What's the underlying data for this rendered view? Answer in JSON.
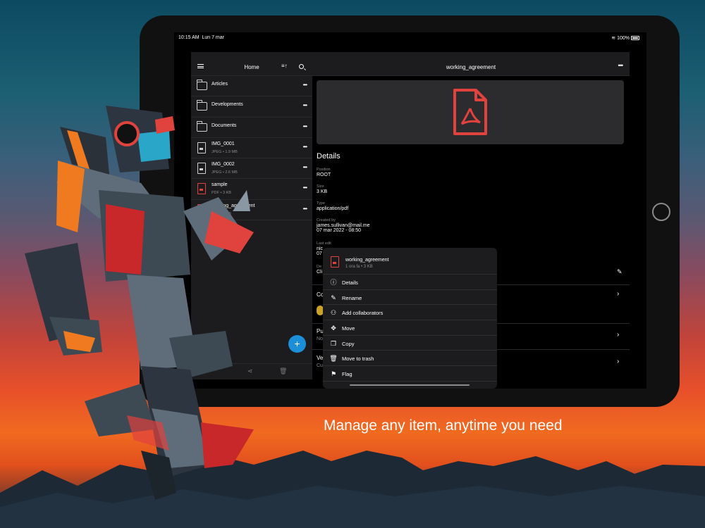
{
  "status_bar": {
    "time": "10:15 AM",
    "date": "Lun 7 mar",
    "battery": "100%"
  },
  "browser": {
    "title": "Home",
    "items": [
      {
        "name": "Articles",
        "type": "folder",
        "meta": ""
      },
      {
        "name": "Developments",
        "type": "folder",
        "meta": ""
      },
      {
        "name": "Documents",
        "type": "folder",
        "meta": ""
      },
      {
        "name": "IMG_0001",
        "type": "image",
        "meta": "JPEG • 1.9 MB"
      },
      {
        "name": "IMG_0002",
        "type": "image",
        "meta": "JPEG • 2.6 MB"
      },
      {
        "name": "sample",
        "type": "pdf",
        "meta": "PDF • 3 KB"
      },
      {
        "name": "working_agreement",
        "type": "pdf",
        "meta": "PDF • 3 KB"
      }
    ],
    "more_label": "•••",
    "add_label": "+"
  },
  "detail": {
    "title": "working_agreement",
    "section_title": "Details",
    "position_label": "Position",
    "position_value": "ROOT",
    "size_label": "Size",
    "size_value": "3 KB",
    "type_label": "Type",
    "type_value": "application/pdf",
    "created_label": "Created by",
    "created_user": "james.sullivan@mail.me",
    "created_date": "07 mar 2022 - 08:50",
    "last_edit_label": "Last edit",
    "last_edit_user": "nic",
    "last_edit_date": "07",
    "desc_label": "De",
    "desc_value": "Cli",
    "collab_label": "Co",
    "public_label": "Pu",
    "public_value": "No",
    "version_label": "Ve",
    "version_value": "Cu"
  },
  "context_menu": {
    "file_name": "working_agreement",
    "file_meta": "1 ora fa • 3 KB",
    "items": [
      {
        "label": "Details",
        "icon": "info-icon"
      },
      {
        "label": "Rename",
        "icon": "pencil-icon"
      },
      {
        "label": "Add collaborators",
        "icon": "add-person-icon"
      },
      {
        "label": "Move",
        "icon": "move-arrows-icon"
      },
      {
        "label": "Copy",
        "icon": "copy-icon"
      },
      {
        "label": "Move to trash",
        "icon": "trash-icon"
      },
      {
        "label": "Flag",
        "icon": "flag-icon"
      }
    ]
  },
  "tagline": "Manage any item, anytime you need",
  "colors": {
    "accent": "#1b8fd8",
    "pdf": "#e0423e",
    "panel": "#1c1c1e"
  }
}
